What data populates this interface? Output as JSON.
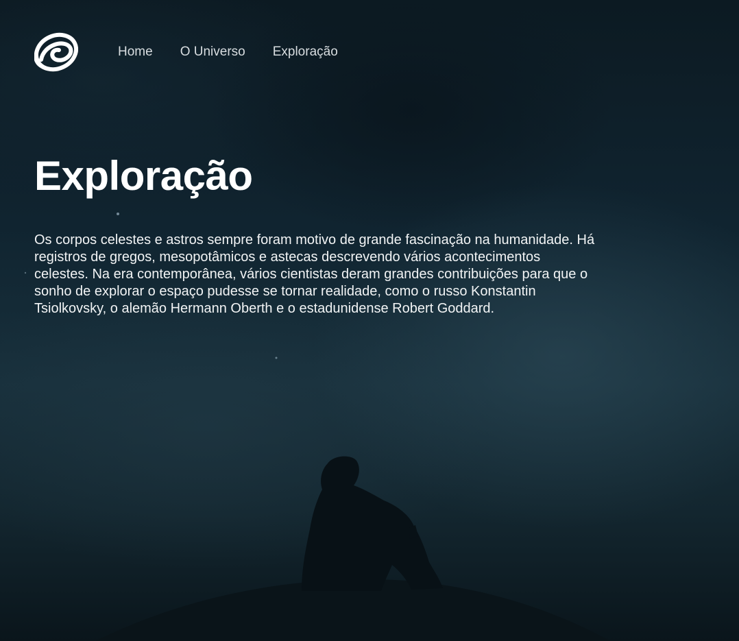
{
  "nav": {
    "logo_icon": "spiral-galaxy-logo-icon",
    "items": [
      {
        "label": "Home"
      },
      {
        "label": "O Universo"
      },
      {
        "label": "Exploração"
      }
    ]
  },
  "hero": {
    "title": "Exploração",
    "text": "Os corpos celestes e astros sempre foram motivo de grande fascinação na humanidade. Há registros de gregos, mesopotâmicos e astecas descrevendo vários acontecimentos celestes. Na era contemporânea, vários cientistas deram grandes contribuições para que o sonho de explorar o espaço pudesse se tornar realidade, como o russo Konstantin Tsiolkovsky, o alemão Hermann Oberth e o estadunidense Robert Goddard."
  },
  "colors": {
    "background": "#102430",
    "text": "#ffffff",
    "nav_text": "#d8dde0"
  }
}
